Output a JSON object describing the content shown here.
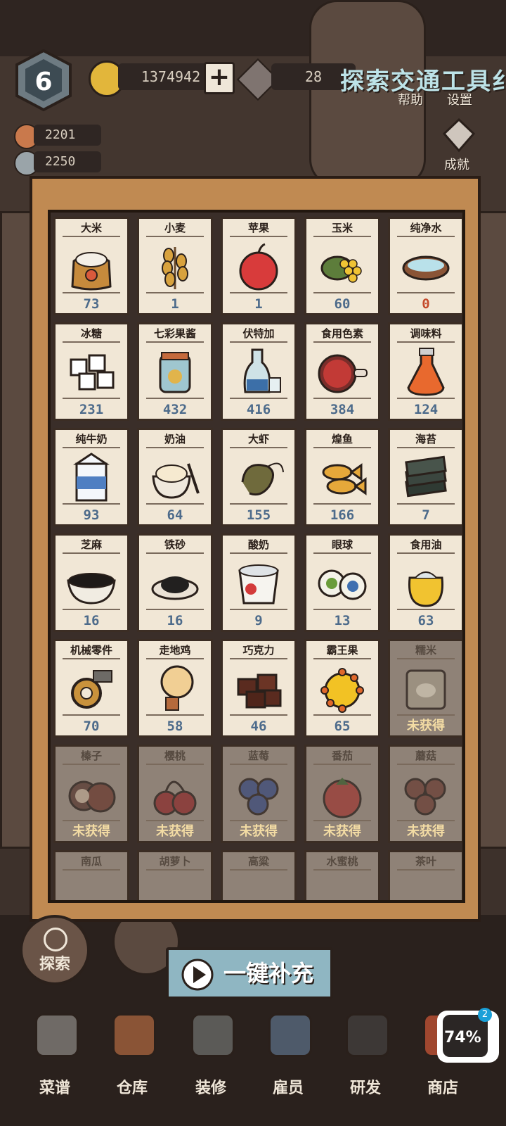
{
  "hud": {
    "level": "6",
    "coins": "1374942",
    "plus_label": "+",
    "gems": "28",
    "title": "探索交通工具纟",
    "help_label": "帮助",
    "settings_label": "设置",
    "stat1": "2201",
    "stat2": "2250",
    "achievement_label": "成就"
  },
  "ingredients": [
    {
      "name": "大米",
      "count": "73",
      "icon": "rice-sack"
    },
    {
      "name": "小麦",
      "count": "1",
      "icon": "wheat"
    },
    {
      "name": "苹果",
      "count": "1",
      "icon": "apple"
    },
    {
      "name": "玉米",
      "count": "60",
      "icon": "corn"
    },
    {
      "name": "纯净水",
      "count": "0",
      "icon": "water-bowl"
    },
    {
      "name": "冰糖",
      "count": "231",
      "icon": "rock-sugar"
    },
    {
      "name": "七彩果酱",
      "count": "432",
      "icon": "jam-jar"
    },
    {
      "name": "伏特加",
      "count": "416",
      "icon": "vodka"
    },
    {
      "name": "食用色素",
      "count": "384",
      "icon": "food-coloring"
    },
    {
      "name": "调味料",
      "count": "124",
      "icon": "seasoning"
    },
    {
      "name": "纯牛奶",
      "count": "93",
      "icon": "milk"
    },
    {
      "name": "奶油",
      "count": "64",
      "icon": "cream"
    },
    {
      "name": "大虾",
      "count": "155",
      "icon": "shrimp"
    },
    {
      "name": "煌鱼",
      "count": "166",
      "icon": "fish"
    },
    {
      "name": "海苔",
      "count": "7",
      "icon": "seaweed"
    },
    {
      "name": "芝麻",
      "count": "16",
      "icon": "sesame"
    },
    {
      "name": "铁砂",
      "count": "16",
      "icon": "iron-sand"
    },
    {
      "name": "酸奶",
      "count": "9",
      "icon": "yogurt"
    },
    {
      "name": "眼球",
      "count": "13",
      "icon": "eyeballs"
    },
    {
      "name": "食用油",
      "count": "63",
      "icon": "oil"
    },
    {
      "name": "机械零件",
      "count": "70",
      "icon": "gear"
    },
    {
      "name": "走地鸡",
      "count": "58",
      "icon": "chicken"
    },
    {
      "name": "巧克力",
      "count": "46",
      "icon": "chocolate"
    },
    {
      "name": "霸王果",
      "count": "65",
      "icon": "spiky-fruit"
    },
    {
      "name": "糯米",
      "count": "未获得",
      "icon": "glutinous-rice",
      "locked": true
    },
    {
      "name": "榛子",
      "count": "未获得",
      "icon": "hazelnut",
      "locked": true
    },
    {
      "name": "樱桃",
      "count": "未获得",
      "icon": "cherry",
      "locked": true
    },
    {
      "name": "蓝莓",
      "count": "未获得",
      "icon": "blueberry",
      "locked": true
    },
    {
      "name": "番茄",
      "count": "未获得",
      "icon": "tomato",
      "locked": true
    },
    {
      "name": "蘑菇",
      "count": "未获得",
      "icon": "mushroom",
      "locked": true
    },
    {
      "name": "南瓜",
      "count": "",
      "icon": "pumpkin",
      "locked": true
    },
    {
      "name": "胡萝卜",
      "count": "",
      "icon": "carrot",
      "locked": true
    },
    {
      "name": "高粱",
      "count": "",
      "icon": "sorghum",
      "locked": true
    },
    {
      "name": "水蜜桃",
      "count": "",
      "icon": "peach",
      "locked": true
    },
    {
      "name": "茶叶",
      "count": "",
      "icon": "tea",
      "locked": true
    }
  ],
  "refill_label": "一键补充",
  "explore_label": "探索",
  "nav": [
    {
      "label": "菜谱",
      "icon": "chef-icon"
    },
    {
      "label": "仓库",
      "icon": "shelf-icon"
    },
    {
      "label": "装修",
      "icon": "hammer-icon"
    },
    {
      "label": "雇员",
      "icon": "employee-icon"
    },
    {
      "label": "研发",
      "icon": "pot-icon"
    },
    {
      "label": "商店",
      "icon": "shop-icon"
    }
  ],
  "overlay": {
    "badge": "2",
    "percent": "74%"
  }
}
